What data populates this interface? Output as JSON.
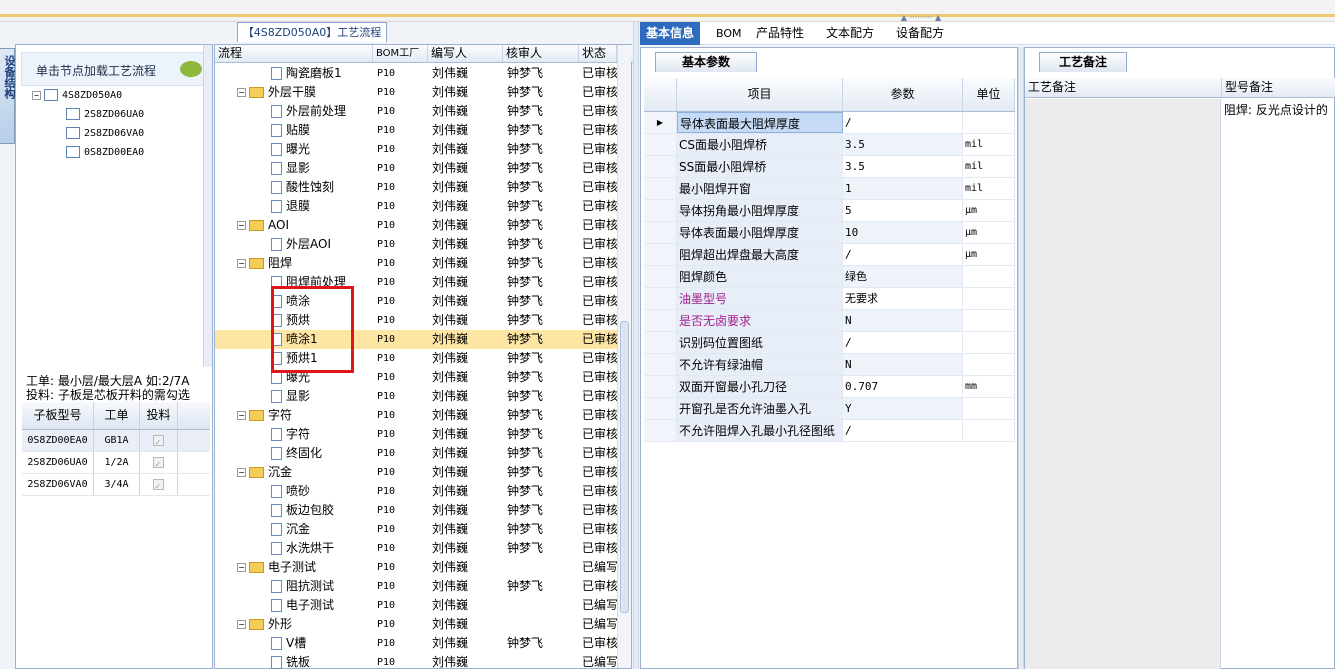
{
  "left": {
    "vtab_label": "设备结构",
    "hint": "单击节点加载工艺流程",
    "tree": [
      {
        "label": "4S8ZD050A0",
        "level": 0,
        "toggle": "-"
      },
      {
        "label": "2S8ZD06UA0",
        "level": 1
      },
      {
        "label": "2S8ZD06VA0",
        "level": 1
      },
      {
        "label": "0S8ZD00EA0",
        "level": 1
      }
    ],
    "info_line1": "工单: 最小层/最大层A 如:2/7A",
    "info_line2": "投料: 子板是芯板开料的需勾选",
    "subgrid": {
      "headers": [
        "子板型号",
        "工单",
        "投料"
      ],
      "rows": [
        {
          "model": "0S8ZD00EA0",
          "order": "GB1A"
        },
        {
          "model": "2S8ZD06UA0",
          "order": "1/2A"
        },
        {
          "model": "2S8ZD06VA0",
          "order": "3/4A"
        }
      ]
    }
  },
  "center": {
    "title": "【4S8ZD050A0】工艺流程",
    "headers": [
      "流程",
      "BOM工厂",
      "编写人",
      "核审人",
      "状态"
    ],
    "rows": [
      {
        "name": "陶瓷磨板1",
        "type": "doc",
        "bom": "P10",
        "writer": "刘伟巍",
        "reviewer": "钟梦飞",
        "status": "已审核"
      },
      {
        "name": "外层干膜",
        "type": "folder",
        "bom": "P10",
        "writer": "刘伟巍",
        "reviewer": "钟梦飞",
        "status": "已审核"
      },
      {
        "name": "外层前处理",
        "type": "doc",
        "bom": "P10",
        "writer": "刘伟巍",
        "reviewer": "钟梦飞",
        "status": "已审核"
      },
      {
        "name": "贴膜",
        "type": "doc",
        "bom": "P10",
        "writer": "刘伟巍",
        "reviewer": "钟梦飞",
        "status": "已审核"
      },
      {
        "name": "曝光",
        "type": "doc",
        "bom": "P10",
        "writer": "刘伟巍",
        "reviewer": "钟梦飞",
        "status": "已审核"
      },
      {
        "name": "显影",
        "type": "doc",
        "bom": "P10",
        "writer": "刘伟巍",
        "reviewer": "钟梦飞",
        "status": "已审核"
      },
      {
        "name": "酸性蚀刻",
        "type": "doc",
        "bom": "P10",
        "writer": "刘伟巍",
        "reviewer": "钟梦飞",
        "status": "已审核"
      },
      {
        "name": "退膜",
        "type": "doc",
        "bom": "P10",
        "writer": "刘伟巍",
        "reviewer": "钟梦飞",
        "status": "已审核"
      },
      {
        "name": "AOI",
        "type": "folder",
        "bom": "P10",
        "writer": "刘伟巍",
        "reviewer": "钟梦飞",
        "status": "已审核"
      },
      {
        "name": "外层AOI",
        "type": "doc",
        "bom": "P10",
        "writer": "刘伟巍",
        "reviewer": "钟梦飞",
        "status": "已审核"
      },
      {
        "name": "阻焊",
        "type": "folder",
        "bom": "P10",
        "writer": "刘伟巍",
        "reviewer": "钟梦飞",
        "status": "已审核"
      },
      {
        "name": "阻焊前处理",
        "type": "doc",
        "bom": "P10",
        "writer": "刘伟巍",
        "reviewer": "钟梦飞",
        "status": "已审核"
      },
      {
        "name": "喷涂",
        "type": "doc",
        "bom": "P10",
        "writer": "刘伟巍",
        "reviewer": "钟梦飞",
        "status": "已审核"
      },
      {
        "name": "预烘",
        "type": "doc",
        "bom": "P10",
        "writer": "刘伟巍",
        "reviewer": "钟梦飞",
        "status": "已审核"
      },
      {
        "name": "喷涂1",
        "type": "doc",
        "bom": "P10",
        "writer": "刘伟巍",
        "reviewer": "钟梦飞",
        "status": "已审核",
        "selected": true
      },
      {
        "name": "预烘1",
        "type": "doc",
        "bom": "P10",
        "writer": "刘伟巍",
        "reviewer": "钟梦飞",
        "status": "已审核"
      },
      {
        "name": "曝光",
        "type": "doc",
        "bom": "P10",
        "writer": "刘伟巍",
        "reviewer": "钟梦飞",
        "status": "已审核"
      },
      {
        "name": "显影",
        "type": "doc",
        "bom": "P10",
        "writer": "刘伟巍",
        "reviewer": "钟梦飞",
        "status": "已审核"
      },
      {
        "name": "字符",
        "type": "folder",
        "bom": "P10",
        "writer": "刘伟巍",
        "reviewer": "钟梦飞",
        "status": "已审核"
      },
      {
        "name": "字符",
        "type": "doc",
        "bom": "P10",
        "writer": "刘伟巍",
        "reviewer": "钟梦飞",
        "status": "已审核"
      },
      {
        "name": "终固化",
        "type": "doc",
        "bom": "P10",
        "writer": "刘伟巍",
        "reviewer": "钟梦飞",
        "status": "已审核"
      },
      {
        "name": "沉金",
        "type": "folder",
        "bom": "P10",
        "writer": "刘伟巍",
        "reviewer": "钟梦飞",
        "status": "已审核"
      },
      {
        "name": "喷砂",
        "type": "doc",
        "bom": "P10",
        "writer": "刘伟巍",
        "reviewer": "钟梦飞",
        "status": "已审核"
      },
      {
        "name": "板边包胶",
        "type": "doc",
        "bom": "P10",
        "writer": "刘伟巍",
        "reviewer": "钟梦飞",
        "status": "已审核"
      },
      {
        "name": "沉金",
        "type": "doc",
        "bom": "P10",
        "writer": "刘伟巍",
        "reviewer": "钟梦飞",
        "status": "已审核"
      },
      {
        "name": "水洗烘干",
        "type": "doc",
        "bom": "P10",
        "writer": "刘伟巍",
        "reviewer": "钟梦飞",
        "status": "已审核"
      },
      {
        "name": "电子测试",
        "type": "folder",
        "bom": "P10",
        "writer": "刘伟巍",
        "reviewer": "",
        "status": "已编写"
      },
      {
        "name": "阻抗测试",
        "type": "doc",
        "bom": "P10",
        "writer": "刘伟巍",
        "reviewer": "钟梦飞",
        "status": "已审核"
      },
      {
        "name": "电子测试",
        "type": "doc",
        "bom": "P10",
        "writer": "刘伟巍",
        "reviewer": "",
        "status": "已编写"
      },
      {
        "name": "外形",
        "type": "folder",
        "bom": "P10",
        "writer": "刘伟巍",
        "reviewer": "",
        "status": "已编写"
      },
      {
        "name": "V槽",
        "type": "doc",
        "bom": "P10",
        "writer": "刘伟巍",
        "reviewer": "钟梦飞",
        "status": "已审核"
      },
      {
        "name": "铣板",
        "type": "doc",
        "bom": "P10",
        "writer": "刘伟巍",
        "reviewer": "",
        "status": "已编写"
      }
    ]
  },
  "tabs": [
    "基本信息",
    "BOM",
    "产品特性",
    "文本配方",
    "设备配方"
  ],
  "mid": {
    "tab": "基本参数",
    "headers": [
      "项目",
      "参数",
      "单位"
    ],
    "rows": [
      {
        "item": "导体表面最大阻焊厚度",
        "param": "/",
        "unit": ""
      },
      {
        "item": "CS面最小阻焊桥",
        "param": "3.5",
        "unit": "mil"
      },
      {
        "item": "SS面最小阻焊桥",
        "param": "3.5",
        "unit": "mil"
      },
      {
        "item": "最小阻焊开窗",
        "param": "1",
        "unit": "mil"
      },
      {
        "item": "导体拐角最小阻焊厚度",
        "param": "5",
        "unit": "μm"
      },
      {
        "item": "导体表面最小阻焊厚度",
        "param": "10",
        "unit": "μm"
      },
      {
        "item": "阻焊超出焊盘最大高度",
        "param": "/",
        "unit": "μm"
      },
      {
        "item": "阻焊颜色",
        "param": "绿色",
        "unit": ""
      },
      {
        "item": "油墨型号",
        "param": "无要求",
        "unit": "",
        "color": "#a21e8c"
      },
      {
        "item": "是否无卤要求",
        "param": "N",
        "unit": "",
        "color": "#a21e8c"
      },
      {
        "item": "识别码位置图纸",
        "param": "/",
        "unit": ""
      },
      {
        "item": "不允许有绿油帽",
        "param": "N",
        "unit": ""
      },
      {
        "item": "双面开窗最小孔刀径",
        "param": "0.707",
        "unit": "mm"
      },
      {
        "item": "开窗孔是否允许油墨入孔",
        "param": "Y",
        "unit": ""
      },
      {
        "item": "不允许阻焊入孔最小孔径图纸",
        "param": "/",
        "unit": ""
      }
    ]
  },
  "right": {
    "tab": "工艺备注",
    "headers": [
      "工艺备注",
      "型号备注"
    ],
    "cell": "阻焊: 反光点设计的"
  }
}
